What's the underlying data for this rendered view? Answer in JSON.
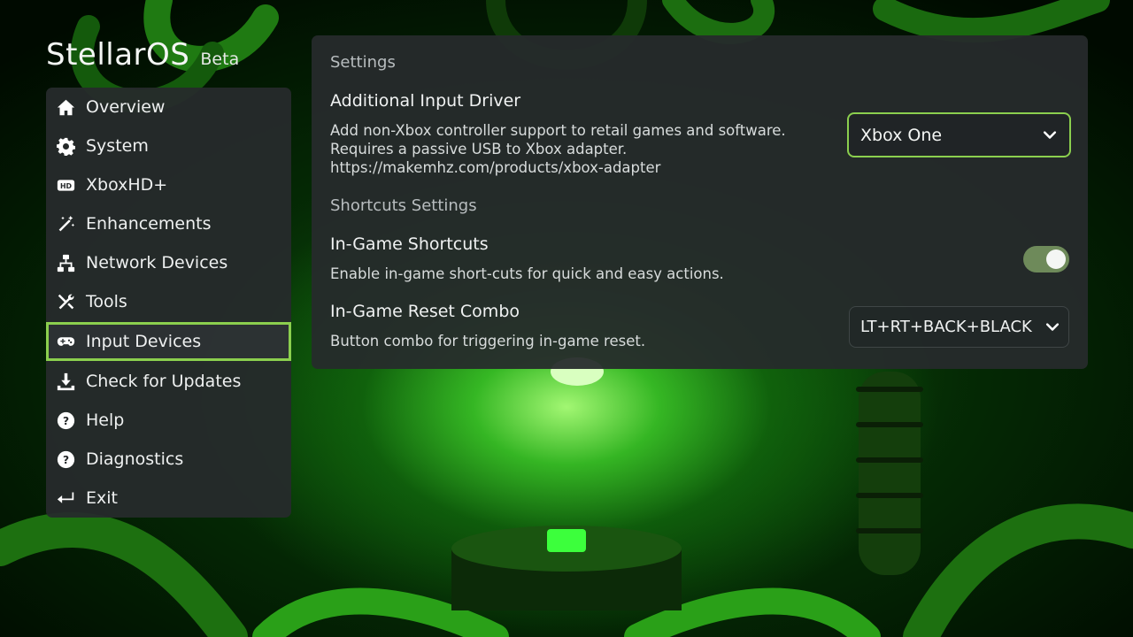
{
  "app": {
    "name": "StellarOS",
    "tag": "Beta"
  },
  "colors": {
    "accent": "#8bcf4e",
    "panel": "#26292b",
    "toggle_on": "#6e8a5a"
  },
  "sidebar": {
    "items": [
      {
        "label": "Overview",
        "icon": "home-icon"
      },
      {
        "label": "System",
        "icon": "gear-icon"
      },
      {
        "label": "XboxHD+",
        "icon": "hd-icon"
      },
      {
        "label": "Enhancements",
        "icon": "magic-wand-icon"
      },
      {
        "label": "Network Devices",
        "icon": "network-icon"
      },
      {
        "label": "Tools",
        "icon": "tools-icon"
      },
      {
        "label": "Input Devices",
        "icon": "gamepad-icon",
        "active": true
      },
      {
        "label": "Check for Updates",
        "icon": "download-icon"
      },
      {
        "label": "Help",
        "icon": "help-icon"
      },
      {
        "label": "Diagnostics",
        "icon": "help-icon"
      },
      {
        "label": "Exit",
        "icon": "exit-icon"
      }
    ]
  },
  "main": {
    "settings_header": "Settings",
    "input_driver": {
      "title": "Additional Input Driver",
      "desc_line1": "Add non-Xbox controller support to retail games and software.",
      "desc_line2": "Requires a passive USB to Xbox adapter.",
      "desc_line3": "https://makemhz.com/products/xbox-adapter",
      "selected": "Xbox One"
    },
    "shortcuts_header": "Shortcuts Settings",
    "ingame_shortcuts": {
      "title": "In-Game Shortcuts",
      "desc": "Enable in-game short-cuts for quick and easy actions.",
      "enabled": true
    },
    "reset_combo": {
      "title": "In-Game Reset Combo",
      "desc": "Button combo for triggering in-game reset.",
      "selected": "LT+RT+BACK+BLACK"
    }
  }
}
